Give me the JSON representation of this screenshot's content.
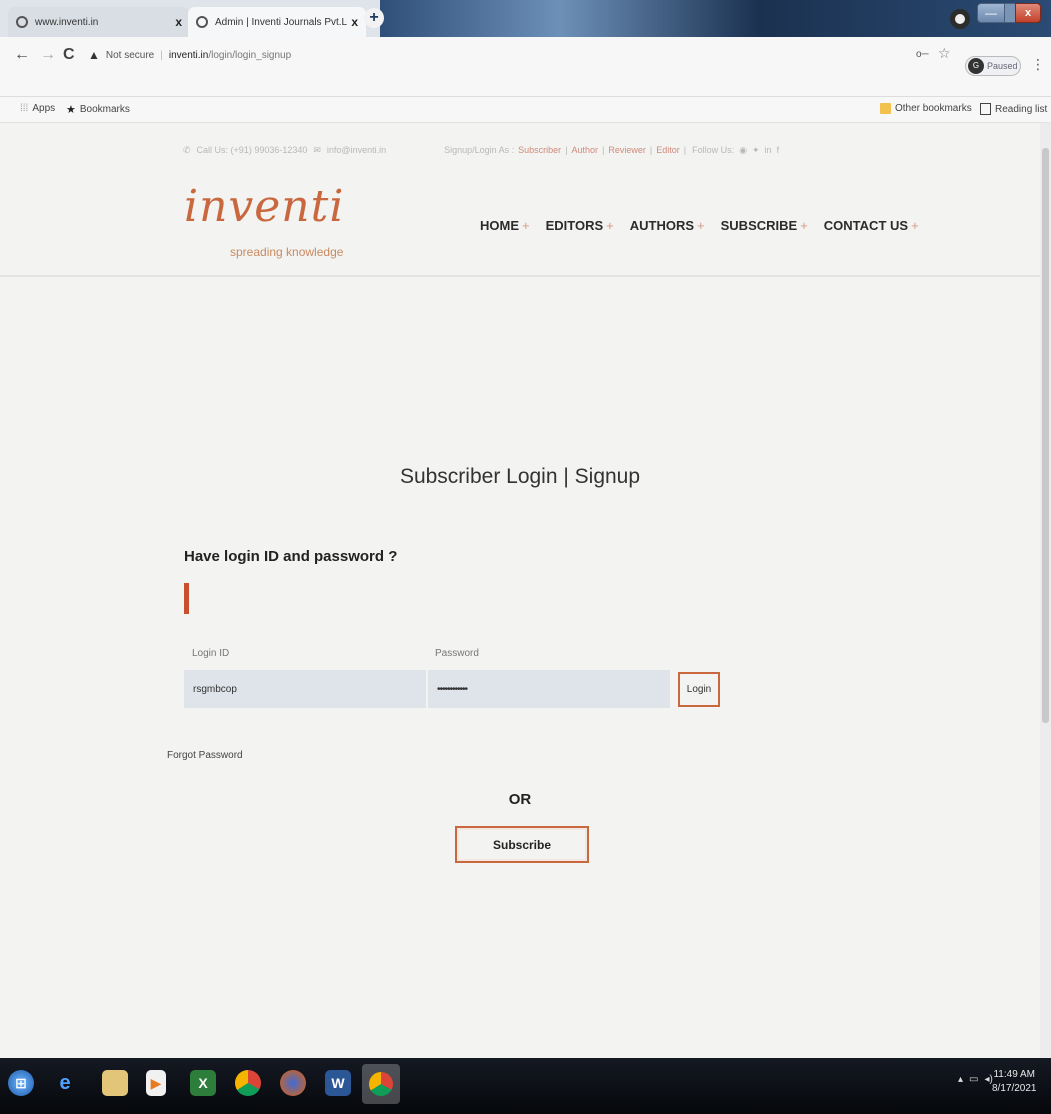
{
  "browser": {
    "tabs": [
      {
        "title": "www.inventi.in",
        "close": "x"
      },
      {
        "title": "Admin | Inventi Journals Pvt.Ltd",
        "close": "x"
      }
    ],
    "new_tab": "+",
    "nav": {
      "back": "←",
      "forward": "→",
      "reload": "C"
    },
    "omnibox": {
      "security": "Not secure",
      "url_host": "inventi.in",
      "url_path": "/login/login_signup"
    },
    "profile": {
      "status": "Paused",
      "initial": "G"
    },
    "window_controls": {
      "minimize": "—",
      "close": "x"
    }
  },
  "bookmarks_bar": {
    "apps": "Apps",
    "bookmarks": "Bookmarks",
    "other": "Other bookmarks",
    "reading_list": "Reading list"
  },
  "site": {
    "topbar": {
      "phone": "Call Us: (+91) 99036-12340",
      "email": "info@inventi.in",
      "signup_prefix": "Signup/Login As :",
      "roles": [
        "Subscriber",
        "Author",
        "Reviewer",
        "Editor"
      ],
      "follow": "Follow Us:"
    },
    "logo": {
      "wordmark": "inventi",
      "tagline": "spreading knowledge"
    },
    "nav": [
      "HOME",
      "EDITORS",
      "AUTHORS",
      "SUBSCRIBE",
      "CONTACT US"
    ],
    "nav_plus": "+"
  },
  "login": {
    "page_title": "Subscriber Login | Signup",
    "section_title": "Have login ID and password ?",
    "login_id_label": "Login ID",
    "login_id_value": "rsgmbcop",
    "password_label": "Password",
    "password_value": "••••••••••••",
    "login_button": "Login",
    "forgot": "Forgot Password",
    "or_text": "OR",
    "subscribe_button": "Subscribe"
  },
  "taskbar": {
    "time": "11:49 AM",
    "date": "8/17/2021"
  },
  "colors": {
    "accent": "#c9673f",
    "page_bg": "#f3f3f1",
    "field_bg": "#dfe4ea"
  }
}
